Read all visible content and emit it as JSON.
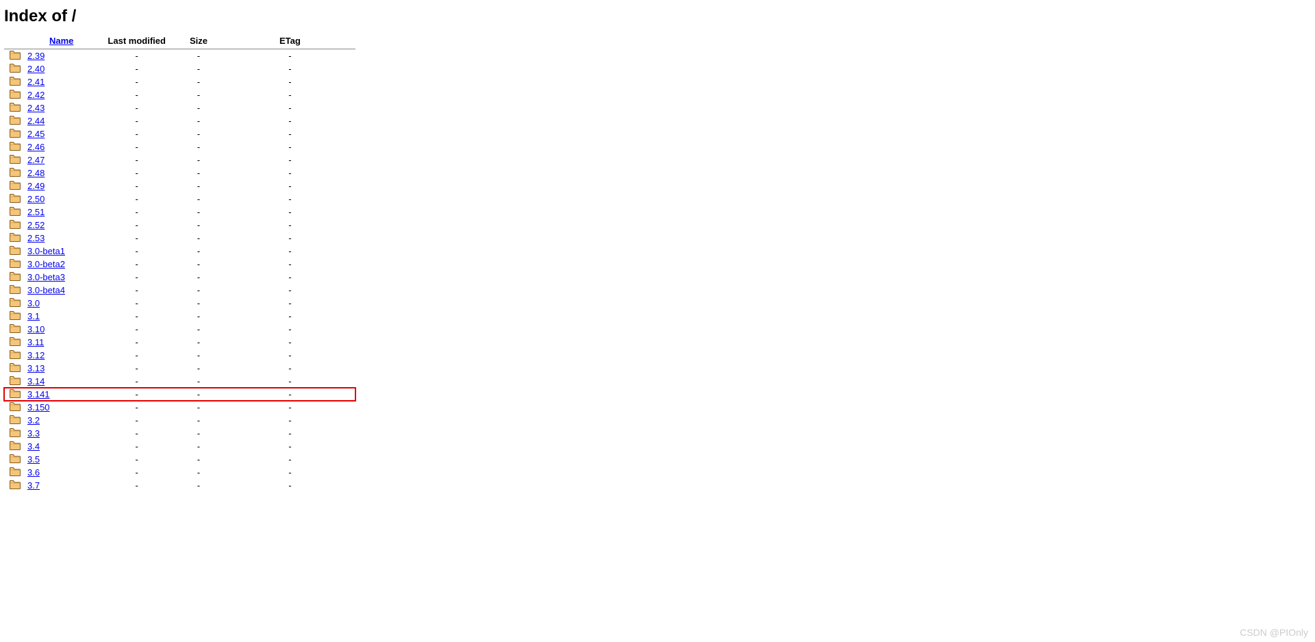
{
  "page_title": "Index of /",
  "headers": {
    "name": "Name",
    "last_modified": "Last modified",
    "size": "Size",
    "etag": "ETag"
  },
  "rows": [
    {
      "name": "2.39",
      "last_modified": "-",
      "size": "-",
      "etag": "-",
      "highlighted": false
    },
    {
      "name": "2.40",
      "last_modified": "-",
      "size": "-",
      "etag": "-",
      "highlighted": false
    },
    {
      "name": "2.41",
      "last_modified": "-",
      "size": "-",
      "etag": "-",
      "highlighted": false
    },
    {
      "name": "2.42",
      "last_modified": "-",
      "size": "-",
      "etag": "-",
      "highlighted": false
    },
    {
      "name": "2.43",
      "last_modified": "-",
      "size": "-",
      "etag": "-",
      "highlighted": false
    },
    {
      "name": "2.44",
      "last_modified": "-",
      "size": "-",
      "etag": "-",
      "highlighted": false
    },
    {
      "name": "2.45",
      "last_modified": "-",
      "size": "-",
      "etag": "-",
      "highlighted": false
    },
    {
      "name": "2.46",
      "last_modified": "-",
      "size": "-",
      "etag": "-",
      "highlighted": false
    },
    {
      "name": "2.47",
      "last_modified": "-",
      "size": "-",
      "etag": "-",
      "highlighted": false
    },
    {
      "name": "2.48",
      "last_modified": "-",
      "size": "-",
      "etag": "-",
      "highlighted": false
    },
    {
      "name": "2.49",
      "last_modified": "-",
      "size": "-",
      "etag": "-",
      "highlighted": false
    },
    {
      "name": "2.50",
      "last_modified": "-",
      "size": "-",
      "etag": "-",
      "highlighted": false
    },
    {
      "name": "2.51",
      "last_modified": "-",
      "size": "-",
      "etag": "-",
      "highlighted": false
    },
    {
      "name": "2.52",
      "last_modified": "-",
      "size": "-",
      "etag": "-",
      "highlighted": false
    },
    {
      "name": "2.53",
      "last_modified": "-",
      "size": "-",
      "etag": "-",
      "highlighted": false
    },
    {
      "name": "3.0-beta1",
      "last_modified": "-",
      "size": "-",
      "etag": "-",
      "highlighted": false
    },
    {
      "name": "3.0-beta2",
      "last_modified": "-",
      "size": "-",
      "etag": "-",
      "highlighted": false
    },
    {
      "name": "3.0-beta3",
      "last_modified": "-",
      "size": "-",
      "etag": "-",
      "highlighted": false
    },
    {
      "name": "3.0-beta4",
      "last_modified": "-",
      "size": "-",
      "etag": "-",
      "highlighted": false
    },
    {
      "name": "3.0",
      "last_modified": "-",
      "size": "-",
      "etag": "-",
      "highlighted": false
    },
    {
      "name": "3.1",
      "last_modified": "-",
      "size": "-",
      "etag": "-",
      "highlighted": false
    },
    {
      "name": "3.10",
      "last_modified": "-",
      "size": "-",
      "etag": "-",
      "highlighted": false
    },
    {
      "name": "3.11",
      "last_modified": "-",
      "size": "-",
      "etag": "-",
      "highlighted": false
    },
    {
      "name": "3.12",
      "last_modified": "-",
      "size": "-",
      "etag": "-",
      "highlighted": false
    },
    {
      "name": "3.13",
      "last_modified": "-",
      "size": "-",
      "etag": "-",
      "highlighted": false
    },
    {
      "name": "3.14",
      "last_modified": "-",
      "size": "-",
      "etag": "-",
      "highlighted": false
    },
    {
      "name": "3.141",
      "last_modified": "-",
      "size": "-",
      "etag": "-",
      "highlighted": true
    },
    {
      "name": "3.150",
      "last_modified": "-",
      "size": "-",
      "etag": "-",
      "highlighted": false
    },
    {
      "name": "3.2",
      "last_modified": "-",
      "size": "-",
      "etag": "-",
      "highlighted": false
    },
    {
      "name": "3.3",
      "last_modified": "-",
      "size": "-",
      "etag": "-",
      "highlighted": false
    },
    {
      "name": "3.4",
      "last_modified": "-",
      "size": "-",
      "etag": "-",
      "highlighted": false
    },
    {
      "name": "3.5",
      "last_modified": "-",
      "size": "-",
      "etag": "-",
      "highlighted": false
    },
    {
      "name": "3.6",
      "last_modified": "-",
      "size": "-",
      "etag": "-",
      "highlighted": false
    },
    {
      "name": "3.7",
      "last_modified": "-",
      "size": "-",
      "etag": "-",
      "highlighted": false
    }
  ],
  "watermark": "CSDN @PIOnly"
}
